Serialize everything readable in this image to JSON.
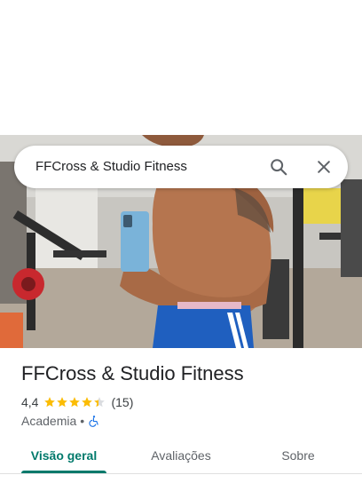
{
  "search": {
    "query": "FFCross & Studio Fitness",
    "search_icon": "search-icon",
    "close_icon": "close-icon"
  },
  "place": {
    "name": "FFCross & Studio Fitness",
    "rating": "4,4",
    "rating_value": 4.4,
    "stars_max": 5,
    "review_count": "(15)",
    "category": "Academia",
    "separator": "•",
    "accessibility_icon": "wheelchair-icon"
  },
  "tabs": [
    {
      "label": "Visão geral",
      "active": true
    },
    {
      "label": "Avaliações",
      "active": false
    },
    {
      "label": "Sobre",
      "active": false
    }
  ],
  "colors": {
    "accent": "#00796b",
    "star": "#fbbc04",
    "access_blue": "#1a73e8"
  }
}
